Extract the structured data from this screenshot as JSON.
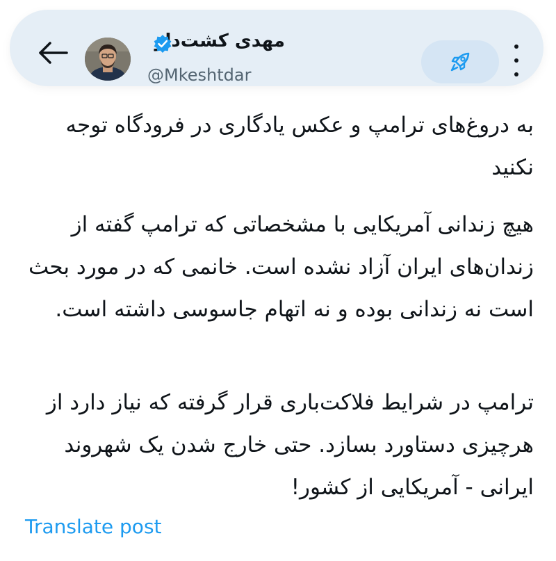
{
  "header": {
    "back_icon": "arrow-left-icon",
    "display_name": "مهدی کشت‌دار",
    "verified_icon": "verified-badge-icon",
    "handle": "@Mkeshtdar",
    "avatar_icon": "avatar",
    "rocket_icon": "rocket-icon",
    "more_icon": "more-vertical-icon",
    "accent_color": "#1d9bf0"
  },
  "post": {
    "paragraphs": [
      "به دروغ‌های ترامپ و عکس یادگاری در فرودگاه توجه نکنید",
      "هیچ زندانی آمریکایی با مشخصاتی که ترامپ گفته از زندان‌های ایران آزاد نشده است. خانمی که در مورد بحث است نه زندانی بوده و نه اتهام جاسوسی داشته است.",
      "ترامپ در شرایط فلاکت‌باری قرار گرفته که نیاز دارد از هرچیزی دستاورد بسازد. حتی خارج شدن یک شهروند ایرانی - آمریکایی از کشور!"
    ],
    "translate_label": "Translate post"
  }
}
